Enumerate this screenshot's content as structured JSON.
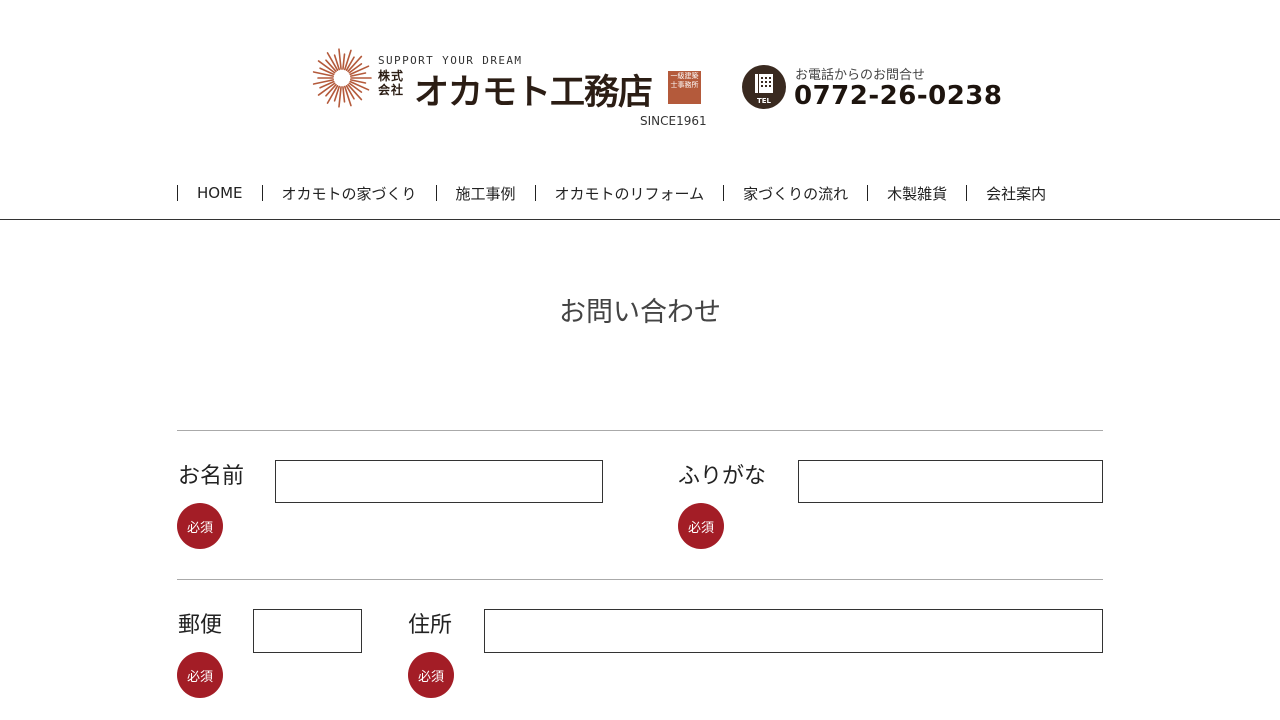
{
  "header": {
    "tagline": "SUPPORT YOUR DREAM",
    "company_prefix": "株式会社",
    "company_name": "オカモト工務店",
    "badge": "一級建築士事務所",
    "since": "SINCE1961",
    "tel_label": "お電話からのお問合せ",
    "tel_number": "0772-26-0238",
    "tel_icon_text": "TEL",
    "brand_color": "#b45a3b",
    "dark_color": "#3a2a20"
  },
  "nav": {
    "items": [
      "HOME",
      "オカモトの家づくり",
      "施工事例",
      "オカモトのリフォーム",
      "家づくりの流れ",
      "木製雑貨",
      "会社案内"
    ]
  },
  "page": {
    "title": "お問い合わせ"
  },
  "form": {
    "required_label": "必須",
    "required_color": "#a31d26",
    "name_label": "お名前",
    "name_value": "",
    "furigana_label": "ふりがな",
    "furigana_value": "",
    "postal_label": "郵便",
    "postal_value": "",
    "address_label": "住所",
    "address_value": ""
  }
}
